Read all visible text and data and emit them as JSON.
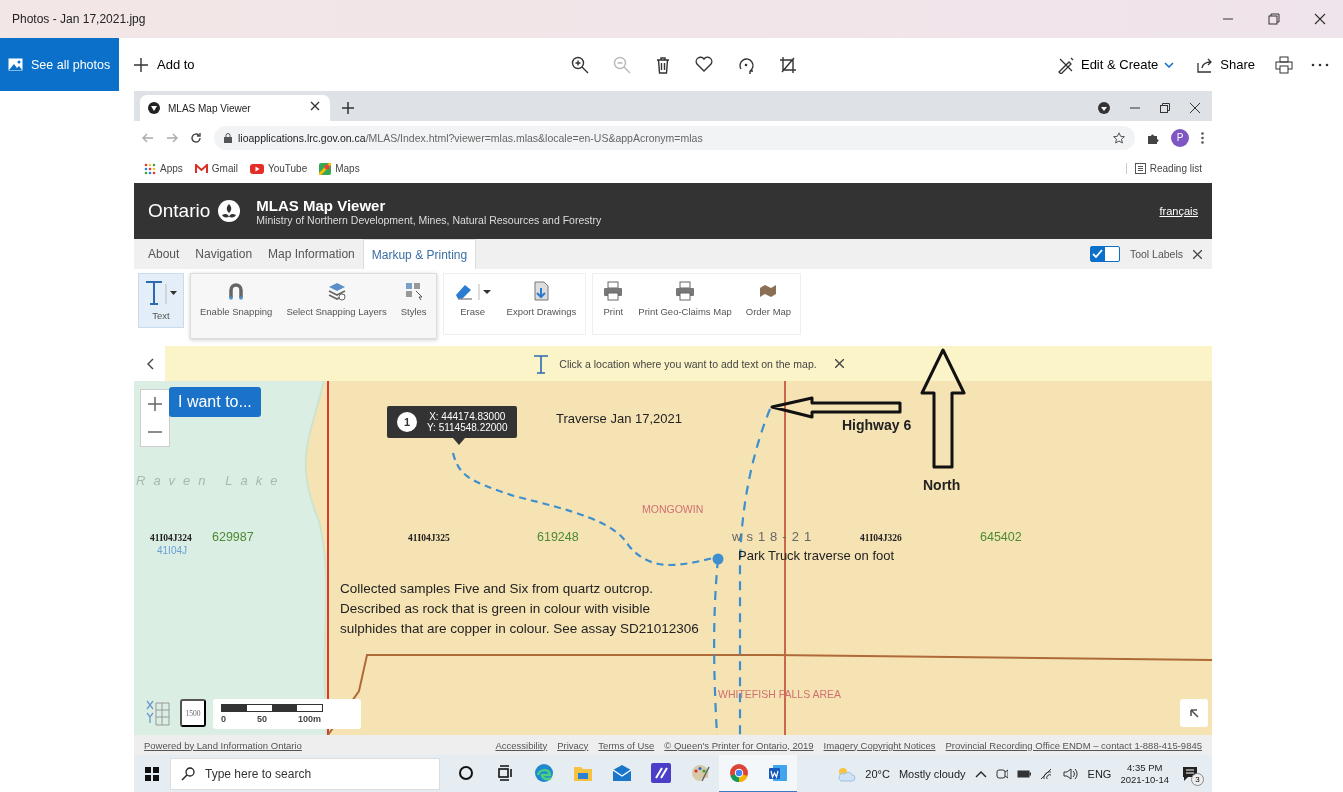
{
  "window": {
    "title": "Photos - Jan 17,2021.jpg"
  },
  "photos_toolbar": {
    "see_all": "See all photos",
    "add_to": "Add to",
    "edit_create": "Edit & Create",
    "share": "Share",
    "tools": [
      {
        "kind": "zoom-in",
        "disabled": false
      },
      {
        "kind": "zoom-out",
        "disabled": true
      },
      {
        "kind": "trash",
        "disabled": false
      },
      {
        "kind": "heart",
        "disabled": false
      },
      {
        "kind": "rotate",
        "disabled": false
      },
      {
        "kind": "crop",
        "disabled": false
      }
    ]
  },
  "browser": {
    "tab": "MLAS Map Viewer",
    "url_host": "lioapplications.lrc.gov.on.ca",
    "url_path": "/MLAS/Index.html?viewer=mlas.mlas&locale=en-US&appAcronym=mlas",
    "profile": "P",
    "bookmarks": [
      {
        "kind": "apps",
        "label": "Apps"
      },
      {
        "kind": "gmail",
        "label": "Gmail"
      },
      {
        "kind": "youtube",
        "label": "YouTube"
      },
      {
        "kind": "maps",
        "label": "Maps"
      }
    ],
    "reading_list": "Reading list"
  },
  "app": {
    "brand": "Ontario",
    "title": "MLAS Map Viewer",
    "subtitle": "Ministry of Northern Development, Mines, Natural Resources and Forestry",
    "language_link": "français",
    "tabs": [
      {
        "label": "About",
        "selected": false
      },
      {
        "label": "Navigation",
        "selected": false
      },
      {
        "label": "Map Information",
        "selected": false
      },
      {
        "label": "Markup & Printing",
        "selected": true
      }
    ],
    "tool_labels": {
      "label": "Tool Labels",
      "checked": true
    },
    "text_tool": {
      "label": "Text",
      "selected": true
    },
    "flyout": [
      {
        "kind": "magnet",
        "label": "Enable Snapping"
      },
      {
        "kind": "layers",
        "label": "Select Snapping Layers"
      },
      {
        "kind": "styles",
        "label": "Styles"
      }
    ],
    "tool_groups": [
      [
        {
          "kind": "eraser",
          "label": "Erase"
        },
        {
          "kind": "export",
          "label": "Export Drawings"
        }
      ],
      [
        {
          "kind": "printer",
          "label": "Print"
        },
        {
          "kind": "printer",
          "label": "Print Geo-Claims Map"
        },
        {
          "kind": "map",
          "label": "Order Map"
        }
      ]
    ],
    "hint": "Click a location where you want to add text on the map."
  },
  "map": {
    "i_want_to": "I want to...",
    "tooltip": {
      "number": "1",
      "x": "X: 444174.83000",
      "y": "Y: 5114548.22000"
    },
    "annotations": [
      {
        "kind": "note",
        "text": "Traverse Jan 17,2021"
      },
      {
        "kind": "bold",
        "text": "Highway 6"
      },
      {
        "kind": "bold",
        "text": "North"
      },
      {
        "kind": "note",
        "text": "Park Truck traverse on foot"
      }
    ],
    "labels": [
      {
        "kind": "lake",
        "text": "Raven Lake"
      },
      {
        "kind": "claim",
        "text": "41I04J324"
      },
      {
        "kind": "grid",
        "text": "41I04J"
      },
      {
        "kind": "cell",
        "text": "629987"
      },
      {
        "kind": "claim",
        "text": "41I04J325"
      },
      {
        "kind": "cell",
        "text": "619248"
      },
      {
        "kind": "place",
        "text": "MONGOWIN"
      },
      {
        "kind": "plan",
        "text": "ws18-21"
      },
      {
        "kind": "claim",
        "text": "41I04J326"
      },
      {
        "kind": "cell",
        "text": "645402"
      },
      {
        "kind": "place",
        "text": "WHITEFISH FALLS AREA"
      }
    ],
    "paragraph": "Collected samples Five and Six from quartz outcrop. Described as rock that is green in colour with visible sulphides that are copper in colour. See assay SD21012306",
    "scale_icon": "1500",
    "scale": [
      "0",
      "50",
      "100m"
    ]
  },
  "footer": {
    "credit": "Powered by Land Information Ontario",
    "links": [
      "Accessibility",
      "Privacy",
      "Terms of Use",
      "© Queen's Printer for Ontario, 2019",
      "Imagery Copyright Notices",
      "Provincial Recording Office ENDM – contact 1-888-415-9845"
    ]
  },
  "taskbar": {
    "search_placeholder": "Type here to search",
    "apps": [
      {
        "kind": "cortana",
        "running": false
      },
      {
        "kind": "taskview",
        "running": false
      },
      {
        "kind": "edge",
        "running": false
      },
      {
        "kind": "folder",
        "running": false
      },
      {
        "kind": "mail",
        "running": false
      },
      {
        "kind": "pen",
        "running": false
      },
      {
        "kind": "paint",
        "running": false
      },
      {
        "kind": "chrome",
        "running": true
      },
      {
        "kind": "word",
        "running": true
      }
    ],
    "temperature": "20°C",
    "weather": "Mostly cloudy",
    "language": "ENG",
    "time": "4:35 PM",
    "date": "2021-10-14",
    "notifications": "3"
  }
}
